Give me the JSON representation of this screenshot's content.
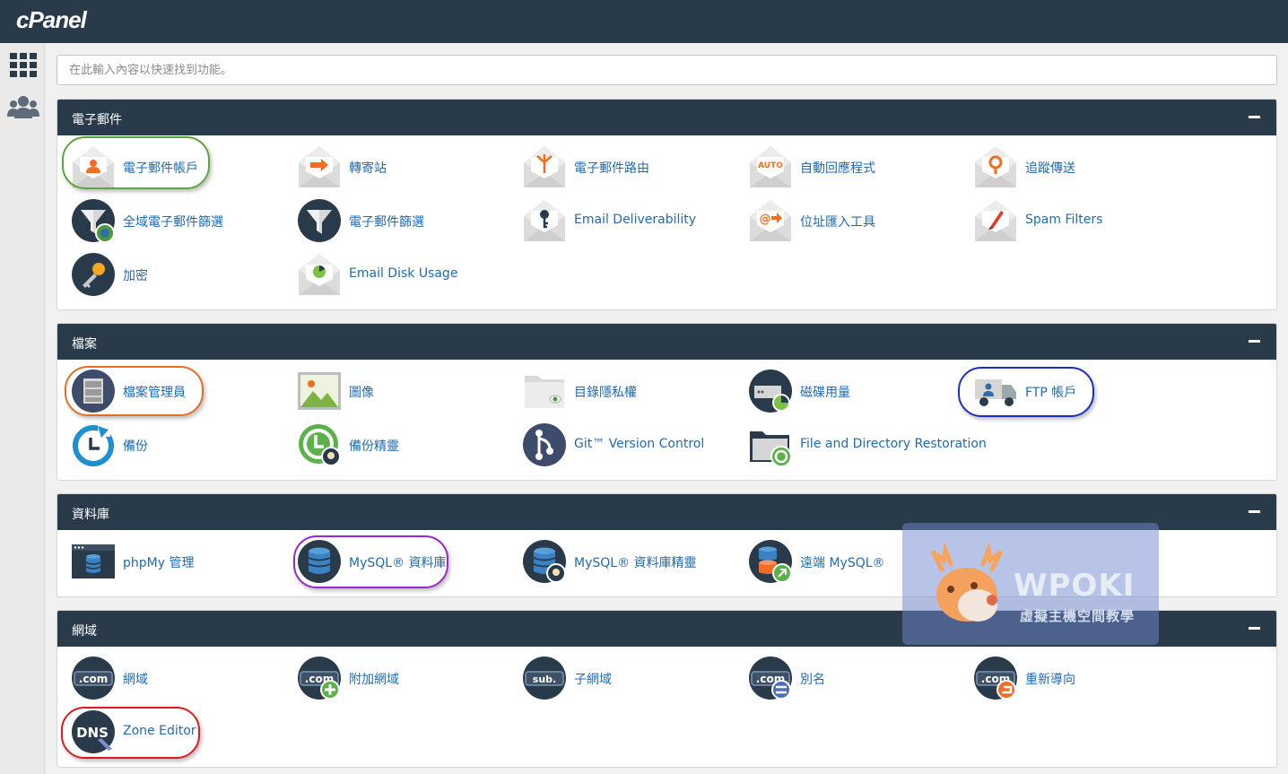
{
  "app": {
    "logo": "cPanel"
  },
  "sidebar": {
    "items": [
      {
        "icon": "grid-icon"
      },
      {
        "icon": "users-icon"
      }
    ]
  },
  "search": {
    "placeholder": "在此輸入內容以快速找到功能。"
  },
  "colors": {
    "header_bg": "#293a4a",
    "link": "#1e6ab4",
    "accent_orange": "#f26c22",
    "highlight_green": "#5da63a",
    "highlight_orange": "#e2701f",
    "highlight_blue": "#1a2ccc",
    "highlight_purple": "#9b24d4",
    "highlight_red": "#e0191e"
  },
  "sections": [
    {
      "title": "電子郵件",
      "items": [
        {
          "label": "電子郵件帳戶",
          "icon": "email-accounts-icon"
        },
        {
          "label": "轉寄站",
          "icon": "forwarders-icon"
        },
        {
          "label": "電子郵件路由",
          "icon": "email-routing-icon"
        },
        {
          "label": "自動回應程式",
          "icon": "autoresponders-icon"
        },
        {
          "label": "追蹤傳送",
          "icon": "track-delivery-icon"
        },
        {
          "label": "全域電子郵件篩選",
          "icon": "global-email-filters-icon"
        },
        {
          "label": "電子郵件篩選",
          "icon": "email-filters-icon"
        },
        {
          "label": "Email Deliverability",
          "icon": "email-deliverability-icon"
        },
        {
          "label": "位址匯入工具",
          "icon": "address-importer-icon"
        },
        {
          "label": "Spam Filters",
          "icon": "spam-filters-icon"
        },
        {
          "label": "加密",
          "icon": "encryption-icon"
        },
        {
          "label": "Email Disk Usage",
          "icon": "email-disk-usage-icon"
        }
      ]
    },
    {
      "title": "檔案",
      "items": [
        {
          "label": "檔案管理員",
          "icon": "file-manager-icon"
        },
        {
          "label": "圖像",
          "icon": "images-icon"
        },
        {
          "label": "目錄隱私權",
          "icon": "directory-privacy-icon"
        },
        {
          "label": "磁碟用量",
          "icon": "disk-usage-icon"
        },
        {
          "label": "FTP 帳戶",
          "icon": "ftp-accounts-icon"
        },
        {
          "label": "備份",
          "icon": "backup-icon"
        },
        {
          "label": "備份精靈",
          "icon": "backup-wizard-icon"
        },
        {
          "label": "Git™ Version Control",
          "icon": "git-icon"
        },
        {
          "label": "File and Directory Restoration",
          "icon": "file-restoration-icon"
        }
      ]
    },
    {
      "title": "資料庫",
      "items": [
        {
          "label": "phpMy 管理",
          "icon": "phpmyadmin-icon"
        },
        {
          "label": "MySQL® 資料庫",
          "icon": "mysql-databases-icon"
        },
        {
          "label": "MySQL® 資料庫精靈",
          "icon": "mysql-wizard-icon"
        },
        {
          "label": "遠端 MySQL®",
          "icon": "remote-mysql-icon"
        }
      ]
    },
    {
      "title": "網域",
      "items": [
        {
          "label": "網域",
          "icon": "domains-icon",
          "badge": ".com"
        },
        {
          "label": "附加網域",
          "icon": "addon-domains-icon",
          "badge": ".com"
        },
        {
          "label": "子網域",
          "icon": "subdomains-icon",
          "badge": "sub."
        },
        {
          "label": "別名",
          "icon": "aliases-icon",
          "badge": ".com"
        },
        {
          "label": "重新導向",
          "icon": "redirects-icon",
          "badge": ".com"
        },
        {
          "label": "Zone Editor",
          "icon": "zone-editor-icon",
          "badge": "DNS"
        }
      ]
    }
  ],
  "watermark": {
    "title": "WPOKI",
    "subtitle": "虛擬主機空間教學",
    "icon": "deer-logo-icon"
  }
}
